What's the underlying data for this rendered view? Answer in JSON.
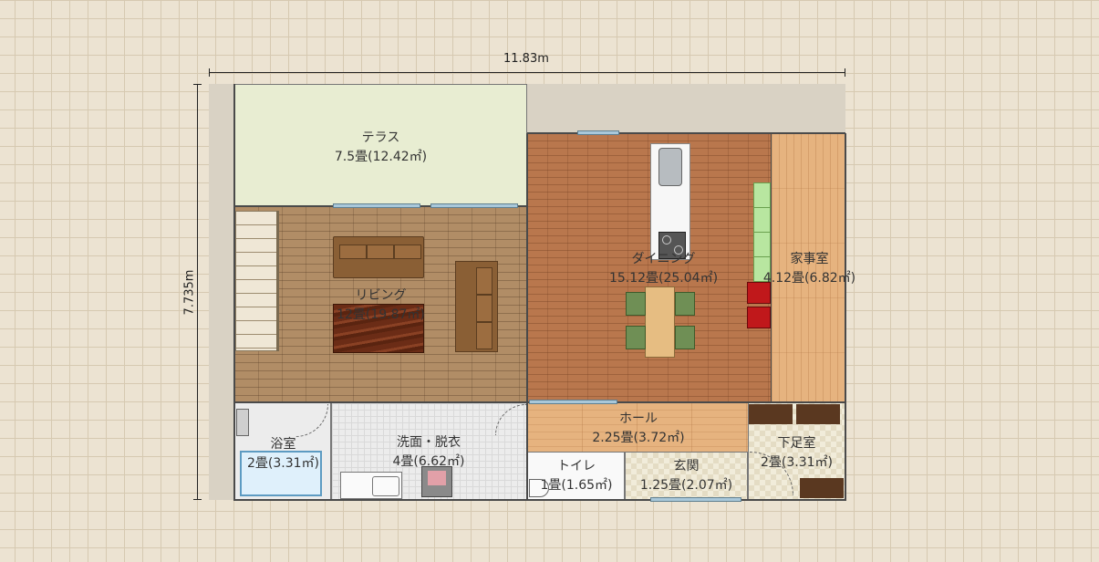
{
  "dimensions": {
    "width": "11.83m",
    "height": "7.735m"
  },
  "rooms": {
    "terrace": {
      "name": "テラス",
      "area": "7.5畳(12.42㎡)"
    },
    "living": {
      "name": "リビング",
      "area": "12畳(19.87㎡)"
    },
    "dining": {
      "name": "ダイニング",
      "area": "15.12畳(25.04㎡)"
    },
    "utility": {
      "name": "家事室",
      "area": "4.12畳(6.82㎡)"
    },
    "bath": {
      "name": "浴室",
      "area": "2畳(3.31㎡)"
    },
    "washroom": {
      "name": "洗面・脱衣",
      "area": "4畳(6.62㎡)"
    },
    "hall": {
      "name": "ホール",
      "area": "2.25畳(3.72㎡)"
    },
    "toilet": {
      "name": "トイレ",
      "area": "1畳(1.65㎡)"
    },
    "entrance": {
      "name": "玄関",
      "area": "1.25畳(2.07㎡)"
    },
    "shoe_room": {
      "name": "下足室",
      "area": "2畳(3.31㎡)"
    }
  },
  "colors": {
    "wall": "#4a4a4a",
    "terrace": "#e8edd2",
    "living_floor": "#b18d66",
    "dining_floor": "#b9774d",
    "utility_floor": "#e6b37f",
    "sofa": "#8a5f35",
    "chair": "#6f8f55",
    "accent_red": "#c0181b"
  },
  "icons": [
    "stairs-icon",
    "sofa-icon",
    "rug-icon",
    "kitchen-island-icon",
    "sink-icon",
    "stove-icon",
    "dining-table-icon",
    "chair-icon",
    "bathtub-icon",
    "toilet-icon",
    "washing-machine-icon",
    "vanity-icon",
    "shelf-icon",
    "slippers-icon",
    "door-swing-icon"
  ]
}
